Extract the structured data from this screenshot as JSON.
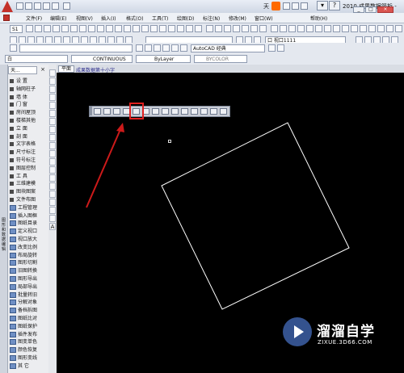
{
  "titlebar": {
    "title": "天",
    "title_right": "2010    成果数据简析 -",
    "brand_color": "#c4312a"
  },
  "menubar": {
    "items": [
      "文件(F)",
      "编辑(E)",
      "视图(V)",
      "插入(I)",
      "格式(O)",
      "工具(T)",
      "绘图(D)",
      "标注(N)",
      "修改(M)",
      "窗口(W)",
      "帮助(H)"
    ]
  },
  "toolbar2": {
    "scale_combo": "S1",
    "view_combo": "口 视口1111"
  },
  "toolbar3": {
    "workspace": "AutoCAD 经典"
  },
  "properties": {
    "layer": "白",
    "linetype": "CONTINUOUS",
    "lineweight": "ByLayer",
    "plotstyle": "BYCOLOR"
  },
  "leftpanel": {
    "header": "天...",
    "vertical_tab": "图形和数据编辑",
    "items": [
      "设  置",
      "轴网柱子",
      "墙  体",
      "门  窗",
      "房间屋顶",
      "楼梯其他",
      "立  面",
      "剖  面",
      "文字表格",
      "尺寸标注",
      "符号标注",
      "图层控制",
      "工  具",
      "三维建模",
      "图块图案",
      "文件布图",
      "工程管理",
      "插入图框",
      "图纸目录",
      "定义视口",
      "视口放大",
      "改变比例",
      "布局旋转",
      "图形切割",
      "旧图转换",
      "图形导出",
      "局部导出",
      "批量转旧",
      "分解对象",
      "备档拆图",
      "图纸比对",
      "图纸保护",
      "插件发布",
      "图变单色",
      "颜色恢复",
      "图形变线",
      "其  它"
    ]
  },
  "drawing": {
    "tab_active": "平面",
    "tab_second": "成果数据第十小字",
    "shape_color": "#ffffff",
    "highlight_color": "#e02020",
    "arrow_color": "#cc1a1a"
  },
  "watermark": {
    "title": "溜溜自学",
    "url": "ZIXUE.3D66.COM"
  }
}
